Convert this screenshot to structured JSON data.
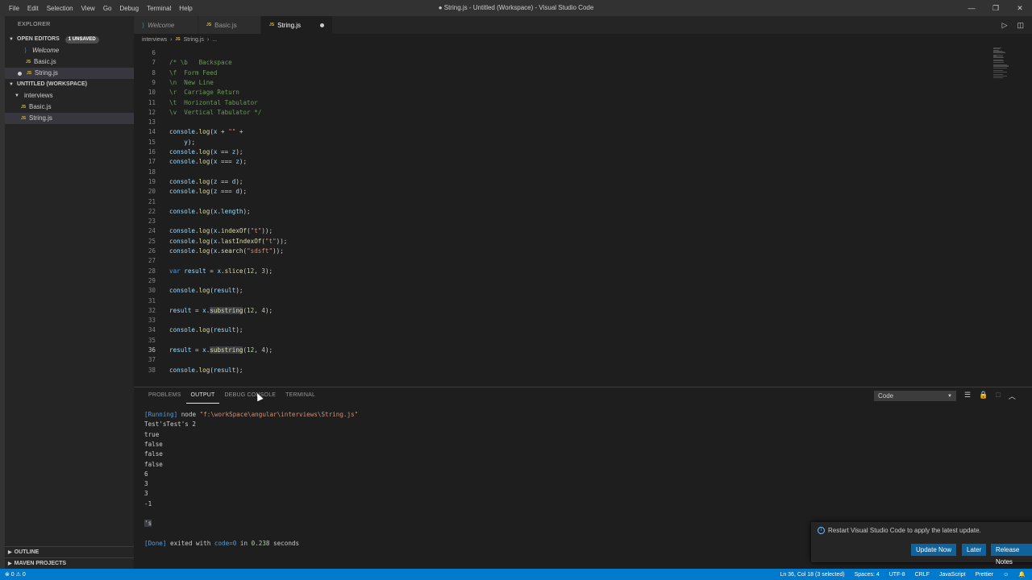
{
  "titlebar": {
    "menu": [
      "File",
      "Edit",
      "Selection",
      "View",
      "Go",
      "Debug",
      "Terminal",
      "Help"
    ],
    "title": "● String.js - Untitled (Workspace) - Visual Studio Code",
    "controls": [
      "—",
      "❐",
      "✕"
    ]
  },
  "sidebar": {
    "title": "EXPLORER",
    "open_editors": {
      "label": "OPEN EDITORS",
      "badge": "1 UNSAVED",
      "items": [
        "Welcome",
        "Basic.js",
        "String.js"
      ]
    },
    "workspace": {
      "label": "UNTITLED (WORKSPACE)",
      "folder": "interviews",
      "files": [
        "Basic.js",
        "String.js"
      ]
    },
    "outline": "OUTLINE",
    "maven": "MAVEN PROJECTS"
  },
  "tabs": [
    {
      "label": "Welcome",
      "icon": "vscode-icon"
    },
    {
      "label": "Basic.js",
      "icon": "js-icon"
    },
    {
      "label": "String.js",
      "icon": "js-icon"
    }
  ],
  "breadcrumb": [
    "interviews",
    "›",
    "JS",
    "String.js",
    "›",
    "..."
  ],
  "code": [
    {
      "n": "6",
      "t": ""
    },
    {
      "n": "7",
      "t": "/* \\b   Backspace"
    },
    {
      "n": "8",
      "t": "\\f  Form Feed"
    },
    {
      "n": "9",
      "t": "\\n  New Line"
    },
    {
      "n": "10",
      "t": "\\r  Carriage Return"
    },
    {
      "n": "11",
      "t": "\\t  Horizontal Tabulator"
    },
    {
      "n": "12",
      "t": "\\v  Vertical Tabulator */"
    },
    {
      "n": "13",
      "t": ""
    },
    {
      "n": "14",
      "t": "console.log(x + \"\" +"
    },
    {
      "n": "15",
      "t": "    y);"
    },
    {
      "n": "16",
      "t": "console.log(x == z);"
    },
    {
      "n": "17",
      "t": "console.log(x === z);"
    },
    {
      "n": "18",
      "t": ""
    },
    {
      "n": "19",
      "t": "console.log(z == d);"
    },
    {
      "n": "20",
      "t": "console.log(z === d);"
    },
    {
      "n": "21",
      "t": ""
    },
    {
      "n": "22",
      "t": "console.log(x.length);"
    },
    {
      "n": "23",
      "t": ""
    },
    {
      "n": "24",
      "t": "console.log(x.indexOf(\"t\"));"
    },
    {
      "n": "25",
      "t": "console.log(x.lastIndexOf(\"t\"));"
    },
    {
      "n": "26",
      "t": "console.log(x.search(\"sdsft\"));"
    },
    {
      "n": "27",
      "t": ""
    },
    {
      "n": "28",
      "t": "var result = x.slice(12, 3);"
    },
    {
      "n": "29",
      "t": ""
    },
    {
      "n": "30",
      "t": "console.log(result);"
    },
    {
      "n": "31",
      "t": ""
    },
    {
      "n": "32",
      "t": "result = x.substring(12, 4);"
    },
    {
      "n": "33",
      "t": ""
    },
    {
      "n": "34",
      "t": "console.log(result);"
    },
    {
      "n": "35",
      "t": ""
    },
    {
      "n": "36",
      "t": "result = x.substring(12, 4);"
    },
    {
      "n": "37",
      "t": ""
    },
    {
      "n": "38",
      "t": "console.log(result);"
    }
  ],
  "panel": {
    "tabs": [
      "PROBLEMS",
      "OUTPUT",
      "DEBUG CONSOLE",
      "TERMINAL"
    ],
    "active_tab": "OUTPUT",
    "channel": "Code",
    "output": [
      "[Running] node \"f:\\workSpace\\angular\\interviews\\String.js\"",
      "Test'sTest's 2",
      "true",
      "false",
      "false",
      "false",
      "6",
      "3",
      "3",
      "-1",
      "",
      "'s",
      "",
      "[Done] exited with code=0 in 0.238 seconds"
    ]
  },
  "notification": {
    "message": "Restart Visual Studio Code to apply the latest update.",
    "buttons": [
      "Update Now",
      "Later",
      "Release Notes"
    ]
  },
  "statusbar": {
    "left": "⊗ 0  ⚠ 0",
    "items": [
      "Ln 36, Col 18 (3 selected)",
      "Spaces: 4",
      "UTF-8",
      "CRLF",
      "JavaScript",
      "Prettier",
      "☺",
      "🔔"
    ]
  }
}
